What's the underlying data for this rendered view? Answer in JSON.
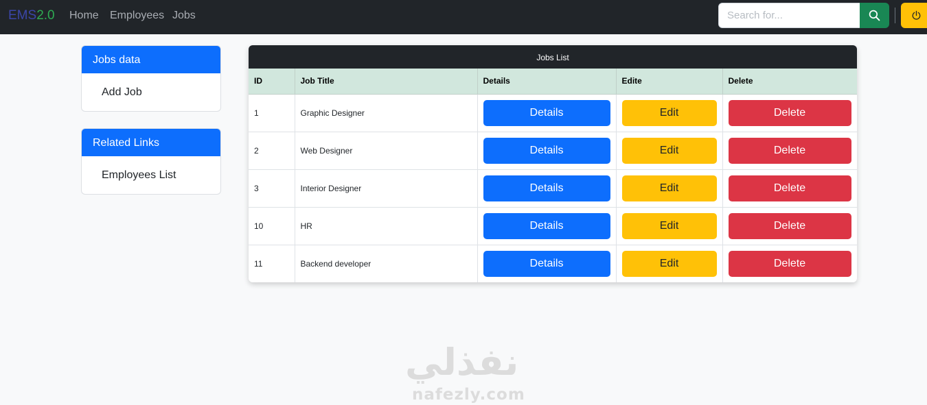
{
  "navbar": {
    "brand_part1": "EMS",
    "brand_part2": "2.0",
    "brand_colors": [
      "#3b46a8",
      "#2eab52"
    ],
    "links": [
      "Home",
      "Employees",
      "Jobs"
    ],
    "search_placeholder": "Search for...",
    "search_icon": "search-icon",
    "power_icon": "power-icon"
  },
  "sidebar": {
    "card1": {
      "header": "Jobs data",
      "link": "Add Job"
    },
    "card2": {
      "header": "Related Links",
      "link": "Employees List"
    }
  },
  "table": {
    "title": "Jobs List",
    "columns": [
      "ID",
      "Job Title",
      "Details",
      "Edite",
      "Delete"
    ],
    "rows": [
      {
        "id": "1",
        "title": "Graphic Designer"
      },
      {
        "id": "2",
        "title": "Web Designer"
      },
      {
        "id": "3",
        "title": "Interior Designer"
      },
      {
        "id": "10",
        "title": "HR"
      },
      {
        "id": "11",
        "title": "Backend developer"
      }
    ],
    "details_label": "Details",
    "edit_label": "Edit",
    "delete_label": "Delete"
  },
  "colors": {
    "primary": "#0d6efd",
    "warning": "#ffc107",
    "danger": "#dc3545",
    "success": "#198754",
    "dark": "#212529",
    "header_row": "#d1e7dd"
  },
  "watermark": {
    "arabic": "نفذلي",
    "latin": "nafezly.com"
  }
}
